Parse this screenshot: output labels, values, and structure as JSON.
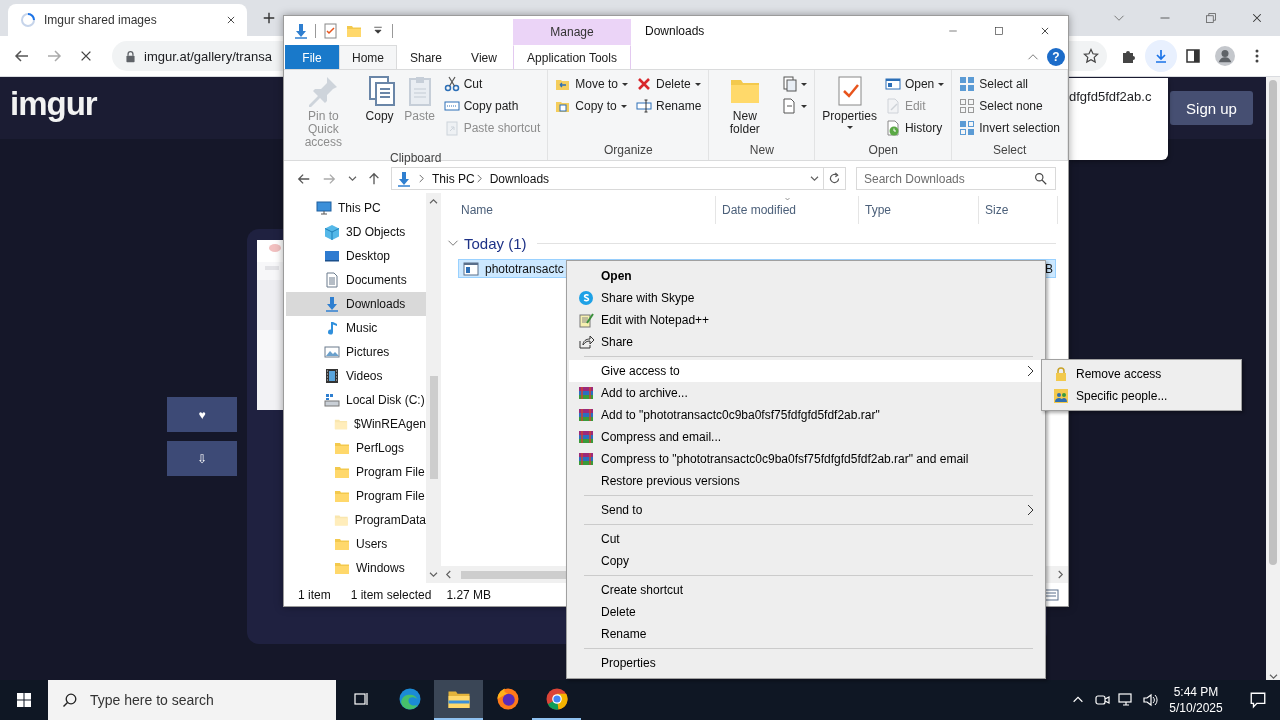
{
  "browser": {
    "tab": {
      "title": "Imgur shared images",
      "loading": true
    },
    "url": "imgur.at/gallery/transa",
    "download_bubble": {
      "text": "dfgfd5fdf2ab.c"
    }
  },
  "page": {
    "logo": "imgur",
    "signup": "Sign up",
    "side_buttons": [
      "♥",
      "⇩"
    ]
  },
  "explorer": {
    "title": "Downloads",
    "context_tab_group": "Manage",
    "help": "?",
    "tabs": [
      {
        "label": "File",
        "kind": "file",
        "selected": false
      },
      {
        "label": "Home",
        "kind": "tab",
        "selected": true
      },
      {
        "label": "Share",
        "kind": "tab",
        "selected": false
      },
      {
        "label": "View",
        "kind": "tab",
        "selected": false
      },
      {
        "label": "Application Tools",
        "kind": "context",
        "selected": false
      }
    ],
    "ribbon": [
      {
        "label": "Clipboard",
        "columns": [
          {
            "kind": "large",
            "label": "Pin to Quick access",
            "disabled": true
          },
          {
            "kind": "large",
            "label": "Copy",
            "disabled": false
          },
          {
            "kind": "large",
            "label": "Paste",
            "disabled": true
          },
          {
            "kind": "stack",
            "items": [
              {
                "label": "Cut",
                "disabled": false
              },
              {
                "label": "Copy path",
                "disabled": false
              },
              {
                "label": "Paste shortcut",
                "disabled": true
              }
            ]
          }
        ]
      },
      {
        "label": "Organize",
        "columns": [
          {
            "kind": "stack",
            "items": [
              {
                "label": "Move to",
                "disabled": false,
                "dropdown": true
              },
              {
                "label": "Copy to",
                "disabled": false,
                "dropdown": true
              }
            ]
          },
          {
            "kind": "stack",
            "items": [
              {
                "label": "Delete",
                "disabled": false,
                "dropdown": true
              },
              {
                "label": "Rename",
                "disabled": false
              }
            ]
          }
        ]
      },
      {
        "label": "New",
        "columns": [
          {
            "kind": "large",
            "label": "New folder",
            "disabled": false
          },
          {
            "kind": "stack",
            "items": [
              {
                "disabled": false,
                "dropdown": true
              },
              {
                "disabled": false,
                "dropdown": true
              }
            ]
          }
        ]
      },
      {
        "label": "Open",
        "columns": [
          {
            "kind": "large",
            "label": "Properties",
            "disabled": false,
            "dropdown": true
          },
          {
            "kind": "stack",
            "items": [
              {
                "label": "Open",
                "disabled": false,
                "dropdown": true
              },
              {
                "label": "Edit",
                "disabled": true
              },
              {
                "label": "History",
                "disabled": false
              }
            ]
          }
        ]
      },
      {
        "label": "Select",
        "columns": [
          {
            "kind": "stack",
            "items": [
              {
                "label": "Select all",
                "disabled": false
              },
              {
                "label": "Select none",
                "disabled": false
              },
              {
                "label": "Invert selection",
                "disabled": false
              }
            ]
          }
        ]
      }
    ],
    "path": [
      "This PC",
      "Downloads"
    ],
    "search_placeholder": "Search Downloads",
    "nav": [
      {
        "label": "This PC",
        "selected": false,
        "hidden": false,
        "children": [
          {
            "label": "3D Objects",
            "selected": false,
            "hidden": false
          },
          {
            "label": "Desktop",
            "selected": false,
            "hidden": false
          },
          {
            "label": "Documents",
            "selected": false,
            "hidden": false
          },
          {
            "label": "Downloads",
            "selected": true,
            "hidden": false
          },
          {
            "label": "Music",
            "selected": false,
            "hidden": false
          },
          {
            "label": "Pictures",
            "selected": false,
            "hidden": false
          },
          {
            "label": "Videos",
            "selected": false,
            "hidden": false
          },
          {
            "label": "Local Disk (C:)",
            "selected": false,
            "hidden": false,
            "children": [
              {
                "label": "$WinREAgen",
                "selected": false,
                "hidden": true
              },
              {
                "label": "PerfLogs",
                "selected": false,
                "hidden": false
              },
              {
                "label": "Program File",
                "selected": false,
                "hidden": false
              },
              {
                "label": "Program File",
                "selected": false,
                "hidden": false
              },
              {
                "label": "ProgramData",
                "selected": false,
                "hidden": true
              },
              {
                "label": "Users",
                "selected": false,
                "hidden": false
              },
              {
                "label": "Windows",
                "selected": false,
                "hidden": false
              }
            ]
          }
        ]
      }
    ],
    "columns": [
      {
        "label": "Name",
        "sorted": false
      },
      {
        "label": "Date modified",
        "sorted": true
      },
      {
        "label": "Type",
        "sorted": false
      },
      {
        "label": "Size",
        "sorted": false
      }
    ],
    "groups": [
      {
        "label": "Today (1)",
        "expanded": true,
        "files": [
          {
            "name": "phototransactc",
            "size": "B",
            "selected": true
          }
        ]
      }
    ],
    "status": [
      "1 item",
      "1 item selected",
      "1.27 MB"
    ]
  },
  "context_menu": [
    {
      "kind": "item",
      "label": "Open",
      "default": true,
      "selected": false,
      "submenu": false
    },
    {
      "kind": "item",
      "label": "Share with Skype",
      "default": false,
      "selected": false,
      "submenu": false
    },
    {
      "kind": "item",
      "label": "Edit with Notepad++",
      "default": false,
      "selected": false,
      "submenu": false
    },
    {
      "kind": "item",
      "label": "Share",
      "default": false,
      "selected": false,
      "submenu": false
    },
    {
      "kind": "separator"
    },
    {
      "kind": "item",
      "label": "Give access to",
      "default": false,
      "selected": true,
      "submenu": true
    },
    {
      "kind": "item",
      "label": "Add to archive...",
      "default": false,
      "selected": false,
      "submenu": false
    },
    {
      "kind": "item",
      "label": "Add to \"phototransactc0c9ba0fsf75fdfgfd5fdf2ab.rar\"",
      "default": false,
      "selected": false,
      "submenu": false
    },
    {
      "kind": "item",
      "label": "Compress and email...",
      "default": false,
      "selected": false,
      "submenu": false
    },
    {
      "kind": "item",
      "label": "Compress to \"phototransactc0c9ba0fsf75fdfgfd5fdf2ab.rar\" and email",
      "default": false,
      "selected": false,
      "submenu": false
    },
    {
      "kind": "item",
      "label": "Restore previous versions",
      "default": false,
      "selected": false,
      "submenu": false
    },
    {
      "kind": "separator"
    },
    {
      "kind": "item",
      "label": "Send to",
      "default": false,
      "selected": false,
      "submenu": true
    },
    {
      "kind": "separator"
    },
    {
      "kind": "item",
      "label": "Cut",
      "default": false,
      "selected": false,
      "submenu": false
    },
    {
      "kind": "item",
      "label": "Copy",
      "default": false,
      "selected": false,
      "submenu": false
    },
    {
      "kind": "separator"
    },
    {
      "kind": "item",
      "label": "Create shortcut",
      "default": false,
      "selected": false,
      "submenu": false
    },
    {
      "kind": "item",
      "label": "Delete",
      "default": false,
      "selected": false,
      "submenu": false
    },
    {
      "kind": "item",
      "label": "Rename",
      "default": false,
      "selected": false,
      "submenu": false
    },
    {
      "kind": "separator"
    },
    {
      "kind": "item",
      "label": "Properties",
      "default": false,
      "selected": false,
      "submenu": false
    }
  ],
  "submenu": [
    {
      "label": "Remove access",
      "selected": false
    },
    {
      "label": "Specific people...",
      "selected": false
    }
  ],
  "taskbar": {
    "search_placeholder": "Type here to search",
    "apps": [
      {
        "active": false,
        "running": false
      },
      {
        "active": false,
        "running": false
      },
      {
        "active": true,
        "running": true
      },
      {
        "active": false,
        "running": false
      },
      {
        "active": false,
        "running": true
      }
    ],
    "time": "5:44 PM",
    "date": "5/10/2025"
  }
}
